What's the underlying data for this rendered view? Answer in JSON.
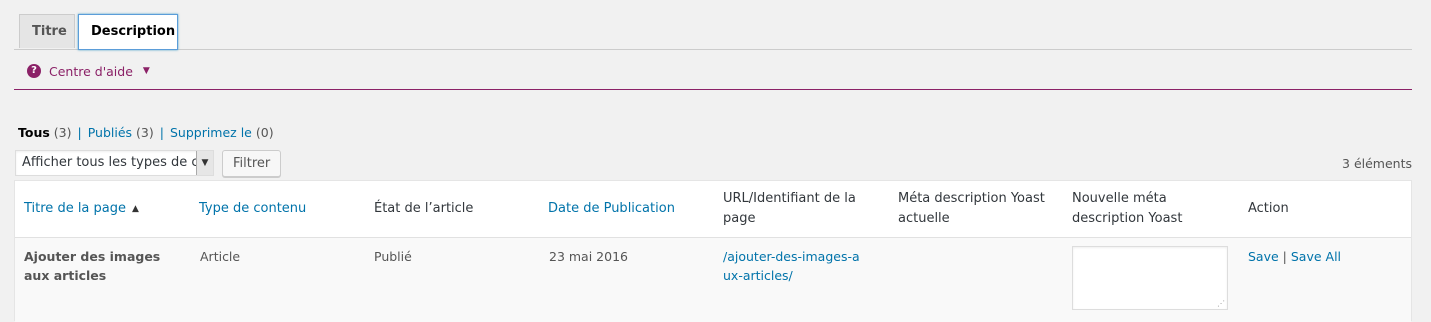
{
  "tabs": [
    {
      "label": "Titre",
      "active": false
    },
    {
      "label": "Description",
      "active": true
    }
  ],
  "help": {
    "label": "Centre d'aide",
    "icon": "question-circle-icon"
  },
  "views": {
    "all": {
      "label": "Tous",
      "count": "(3)"
    },
    "published": {
      "label": "Publiés",
      "count": "(3)"
    },
    "trash": {
      "label": "Supprimez le",
      "count": "(0)"
    }
  },
  "filter": {
    "select_value": "Afficher tous les types de contenu",
    "button": "Filtrer"
  },
  "item_count": "3 éléments",
  "table": {
    "headers": {
      "title": "Titre de la page",
      "type": "Type de contenu",
      "state": "État de l’article",
      "date": "Date de Publication",
      "url": "URL/Identifiant de la page",
      "meta_current": "Méta description Yoast actuelle",
      "meta_new": "Nouvelle méta description Yoast",
      "action": "Action"
    },
    "rows": [
      {
        "title": "Ajouter des images aux articles",
        "type": "Article",
        "state": "Publié",
        "date": "23 mai 2016",
        "url": "/ajouter-des-images-aux-articles/",
        "meta_current": "",
        "meta_new": "",
        "save": "Save",
        "save_all": "Save All"
      }
    ]
  },
  "colors": {
    "accent": "#8b2167",
    "link": "#0073aa"
  }
}
